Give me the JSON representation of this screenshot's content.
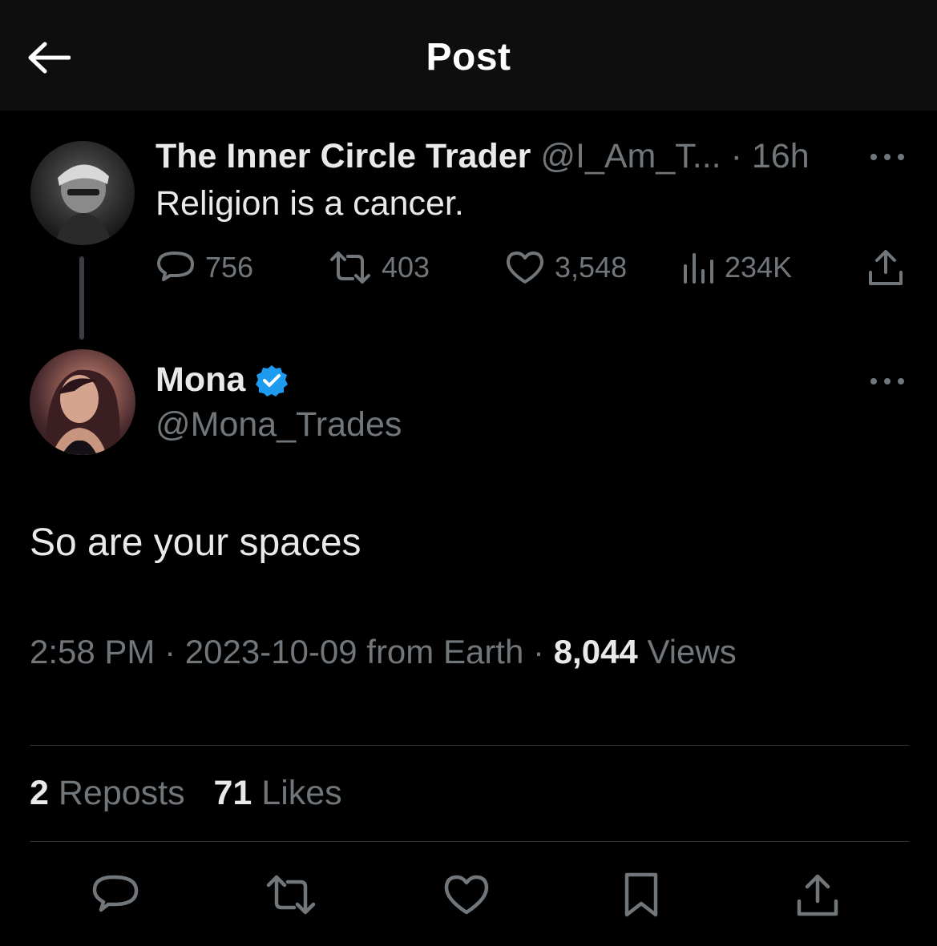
{
  "header": {
    "title": "Post"
  },
  "parent_post": {
    "display_name": "The Inner Circle Trader",
    "handle": "@I_Am_T...",
    "separator": "·",
    "time": "16h",
    "text": "Religion is a cancer.",
    "replies": "756",
    "reposts": "403",
    "likes": "3,548",
    "views": "234K"
  },
  "reply_post": {
    "display_name": "Mona",
    "handle": "@Mona_Trades",
    "verified": true,
    "text": "So are your spaces",
    "time": "2:58 PM",
    "date": "2023-10-09",
    "source": "from Earth",
    "separator": "·",
    "views_count": "8,044",
    "views_label": "Views",
    "reposts_count": "2",
    "reposts_label": "Reposts",
    "likes_count": "71",
    "likes_label": "Likes"
  },
  "colors": {
    "background": "#000000",
    "header_bg": "#0e0e0e",
    "text": "#e7e9ea",
    "muted": "#71767b",
    "verified": "#1d9bf0",
    "divider": "#2f3336"
  },
  "icons": {
    "back": "arrow-left-icon",
    "more": "more-horizontal-icon",
    "reply": "reply-bubble-icon",
    "repost": "repost-icon",
    "like": "heart-icon",
    "views": "analytics-bars-icon",
    "share": "share-upload-icon",
    "bookmark": "bookmark-icon",
    "verified": "verified-badge-icon"
  }
}
